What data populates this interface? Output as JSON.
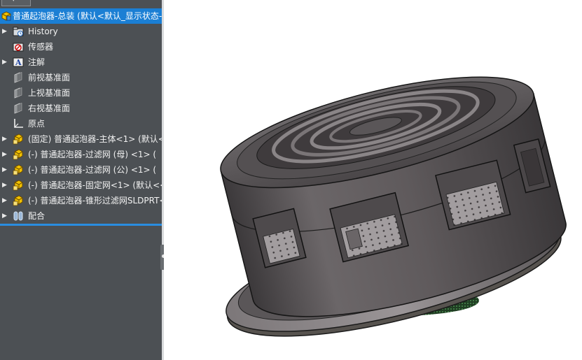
{
  "tree": {
    "root": {
      "label": "普通起泡器-总装 (默认<默认_显示状态-"
    },
    "items": [
      {
        "label": "History",
        "icon": "history-folder-icon",
        "expandable": true
      },
      {
        "label": "传感器",
        "icon": "sensor-icon",
        "expandable": false
      },
      {
        "label": "注解",
        "icon": "annotation-icon",
        "expandable": true
      },
      {
        "label": "前视基准面",
        "icon": "plane-icon",
        "expandable": false
      },
      {
        "label": "上视基准面",
        "icon": "plane-icon",
        "expandable": false
      },
      {
        "label": "右视基准面",
        "icon": "plane-icon",
        "expandable": false
      },
      {
        "label": "原点",
        "icon": "origin-icon",
        "expandable": false
      },
      {
        "label": "(固定) 普通起泡器-主体<1> (默认<",
        "icon": "part-icon",
        "expandable": true
      },
      {
        "label": "(-) 普通起泡器-过滤网 (母) <1> (",
        "icon": "part-icon",
        "expandable": true
      },
      {
        "label": "(-) 普通起泡器-过滤网 (公) <1> (",
        "icon": "part-icon",
        "expandable": true
      },
      {
        "label": "(-) 普通起泡器-固定网<1> (默认<<",
        "icon": "part-icon",
        "expandable": true
      },
      {
        "label": "(-) 普通起泡器-锥形过滤网SLDPRT<",
        "icon": "part-icon",
        "expandable": true
      },
      {
        "label": "配合",
        "icon": "mates-icon",
        "expandable": true
      }
    ]
  },
  "colors": {
    "panel_bg": "#4c5054",
    "selection": "#1b7fd4",
    "part_yellow": "#f2c200",
    "body_gray": "#5f5a5c"
  }
}
